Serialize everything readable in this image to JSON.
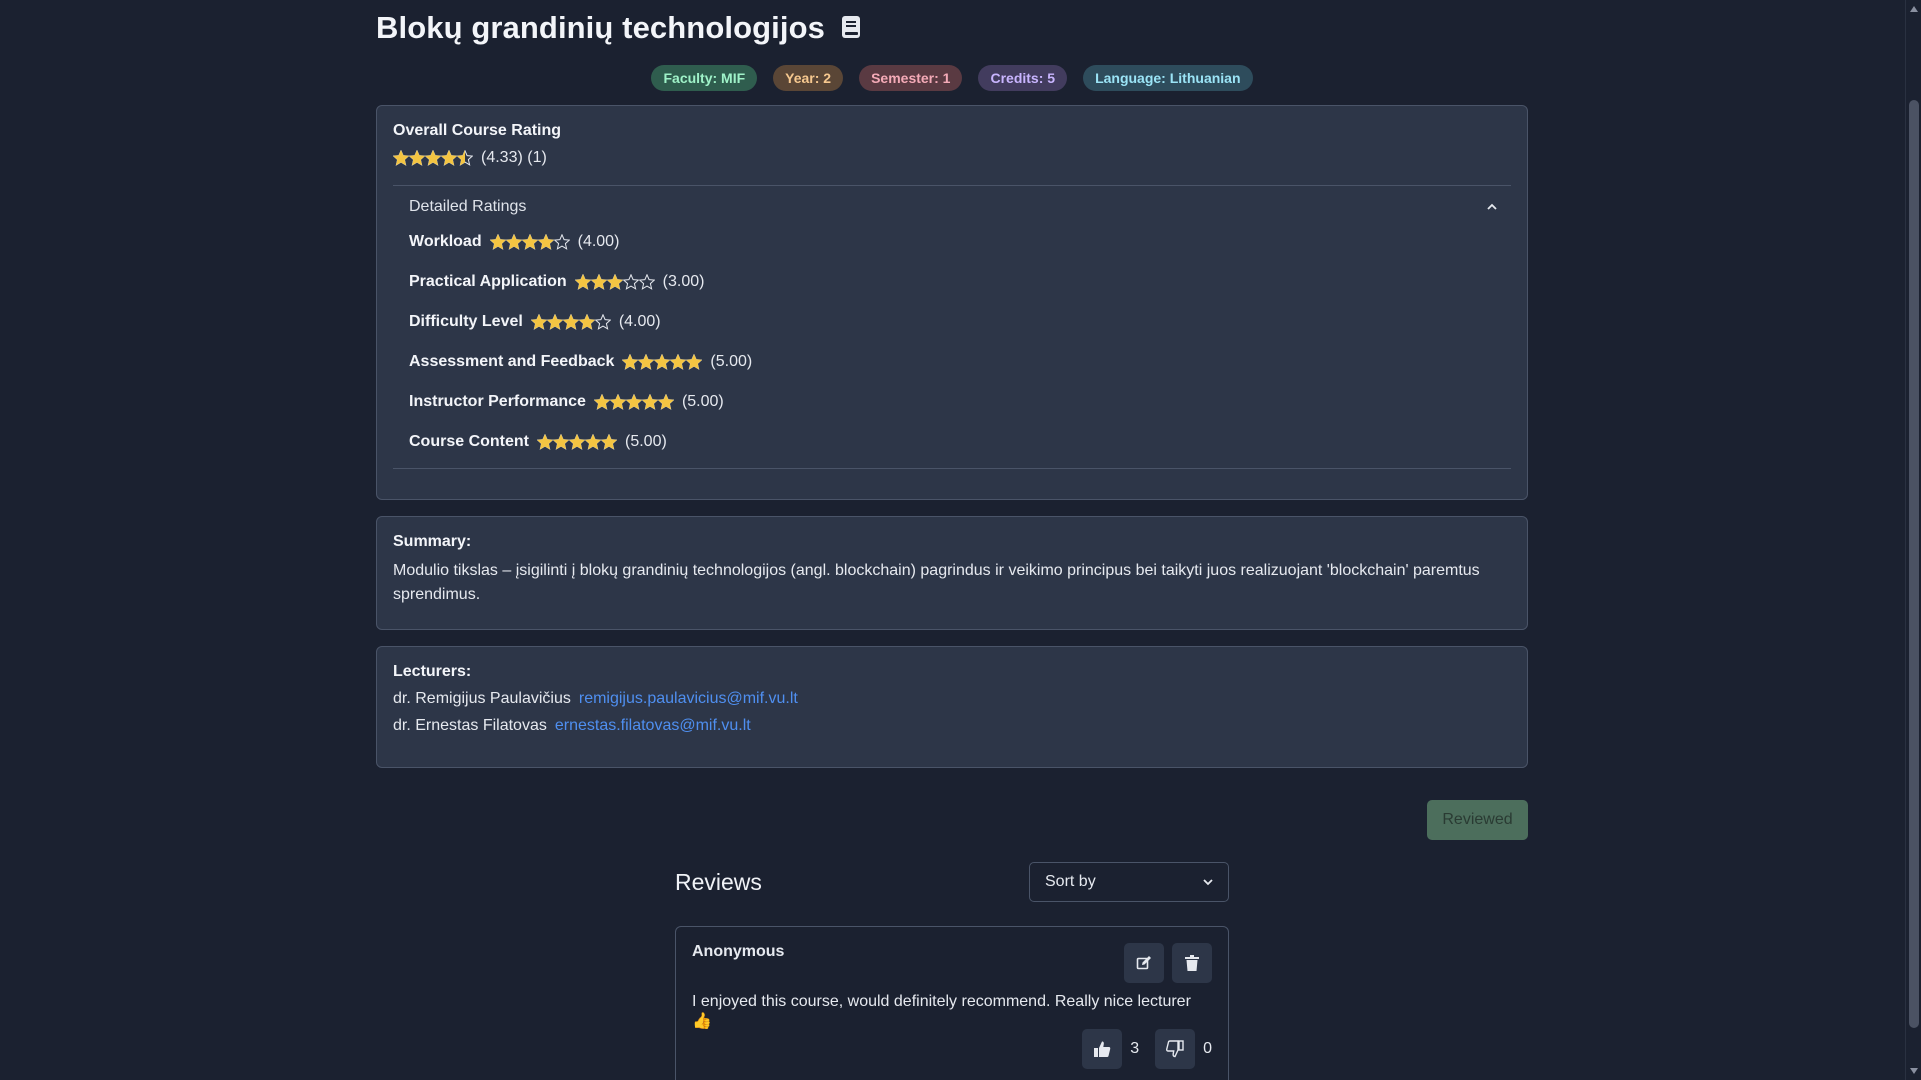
{
  "course": {
    "title": "Blokų grandinių technologijos"
  },
  "badges": [
    {
      "label": "Faculty: MIF",
      "bg": "#2f5d4e",
      "fg": "#9ff2c8"
    },
    {
      "label": "Year: 2",
      "bg": "#5a4636",
      "fg": "#f6c88f"
    },
    {
      "label": "Semester: 1",
      "bg": "#5a3a42",
      "fg": "#f4aab7"
    },
    {
      "label": "Credits: 5",
      "bg": "#423c5e",
      "fg": "#c9b5ff"
    },
    {
      "label": "Language: Lithuanian",
      "bg": "#2e4c5c",
      "fg": "#9be4f6"
    }
  ],
  "overall": {
    "title": "Overall Course Rating",
    "score": "(4.33)",
    "count": "(1)",
    "stars": 4.33
  },
  "detailed": {
    "title": "Detailed Ratings",
    "rows": [
      {
        "label": "Workload",
        "value": "(4.00)",
        "stars": 4
      },
      {
        "label": "Practical Application",
        "value": "(3.00)",
        "stars": 3
      },
      {
        "label": "Difficulty Level",
        "value": "(4.00)",
        "stars": 4
      },
      {
        "label": "Assessment and Feedback",
        "value": "(5.00)",
        "stars": 5
      },
      {
        "label": "Instructor Performance",
        "value": "(5.00)",
        "stars": 5
      },
      {
        "label": "Course Content",
        "value": "(5.00)",
        "stars": 5
      }
    ]
  },
  "summary": {
    "title": "Summary:",
    "text": "Modulio tikslas – įsigilinti į blokų grandinių technologijos (angl. blockchain) pagrindus ir veikimo principus bei taikyti juos realizuojant 'blockchain' paremtus sprendimus."
  },
  "lecturers": {
    "title": "Lecturers:",
    "items": [
      {
        "name": "dr. Remigijus Paulavičius",
        "email": "remigijus.paulavicius@mif.vu.lt"
      },
      {
        "name": "dr. Ernestas Filatovas",
        "email": "ernestas.filatovas@mif.vu.lt"
      }
    ]
  },
  "reviewed_label": "Reviewed",
  "reviews": {
    "title": "Reviews",
    "sort_label": "Sort by",
    "items": [
      {
        "author": "Anonymous",
        "text": "I enjoyed this course, would definitely recommend. Really nice lecturer 👍",
        "likes": "3",
        "dislikes": "0"
      }
    ]
  },
  "colors": {
    "star": "#f4c542",
    "link": "#4f8ff0",
    "reviewed_bg": "#4c6e5c"
  }
}
